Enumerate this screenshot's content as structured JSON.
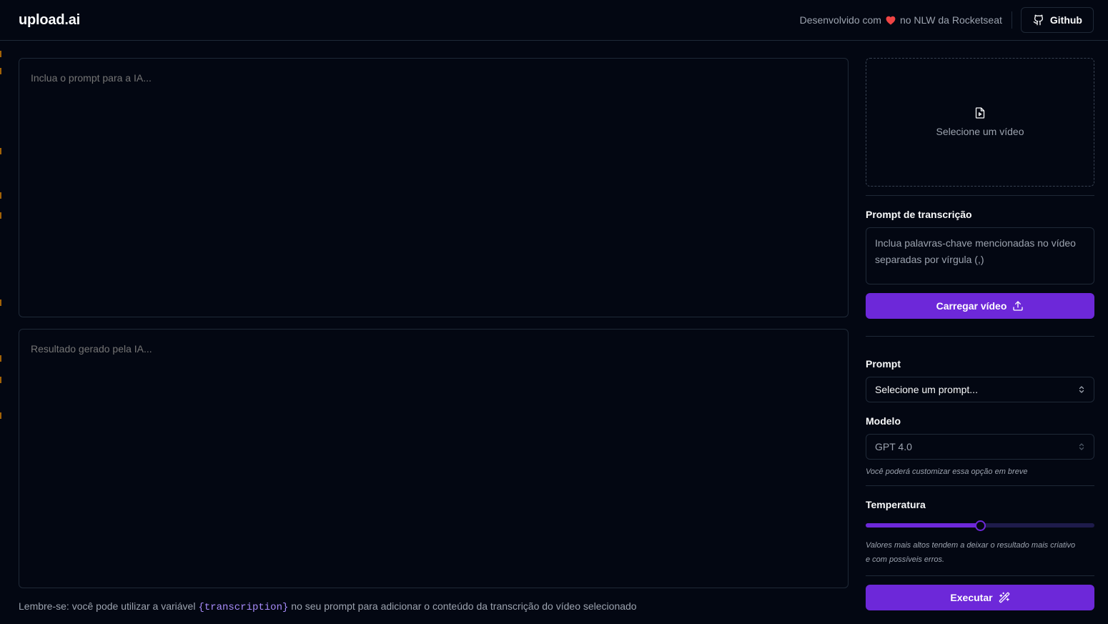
{
  "header": {
    "logo": "upload.ai",
    "credit_before": "Desenvolvido com",
    "credit_after": "no NLW da Rocketseat",
    "heart_color": "#ef4444",
    "github_label": "Github",
    "github_icon": "github-icon"
  },
  "main": {
    "prompt_placeholder": "Inclua o prompt para a IA...",
    "result_placeholder": "Resultado gerado pela IA...",
    "tip_before": "Lembre-se: você pode utilizar a variável",
    "tip_variable": "{transcription}",
    "tip_after": "no seu prompt para adicionar o conteúdo da transcrição do vídeo selecionado"
  },
  "sidebar": {
    "video_select_label": "Selecione um vídeo",
    "video_icon": "file-video-icon",
    "transcription_label": "Prompt de transcrição",
    "transcription_placeholder": "Inclua palavras-chave mencionadas no vídeo separadas por vírgula (,)",
    "upload_button": "Carregar vídeo",
    "upload_icon": "upload-icon",
    "prompt_label": "Prompt",
    "prompt_select": "Selecione um prompt...",
    "model_label": "Modelo",
    "model_select": "GPT 4.0",
    "model_hint": "Você poderá customizar essa opção em breve",
    "temperature_label": "Temperatura",
    "temperature_value": 0.5,
    "temperature_hint_line1": "Valores mais altos tendem a deixar o resultado mais criativo",
    "temperature_hint_line2": "e com possíveis erros.",
    "execute_button": "Executar",
    "execute_icon": "wand-icon"
  },
  "colors": {
    "background": "#030712",
    "border": "#1f2937",
    "accent": "#6d28d9",
    "muted_text": "#9ca3af",
    "code_text": "#a78bfa"
  }
}
